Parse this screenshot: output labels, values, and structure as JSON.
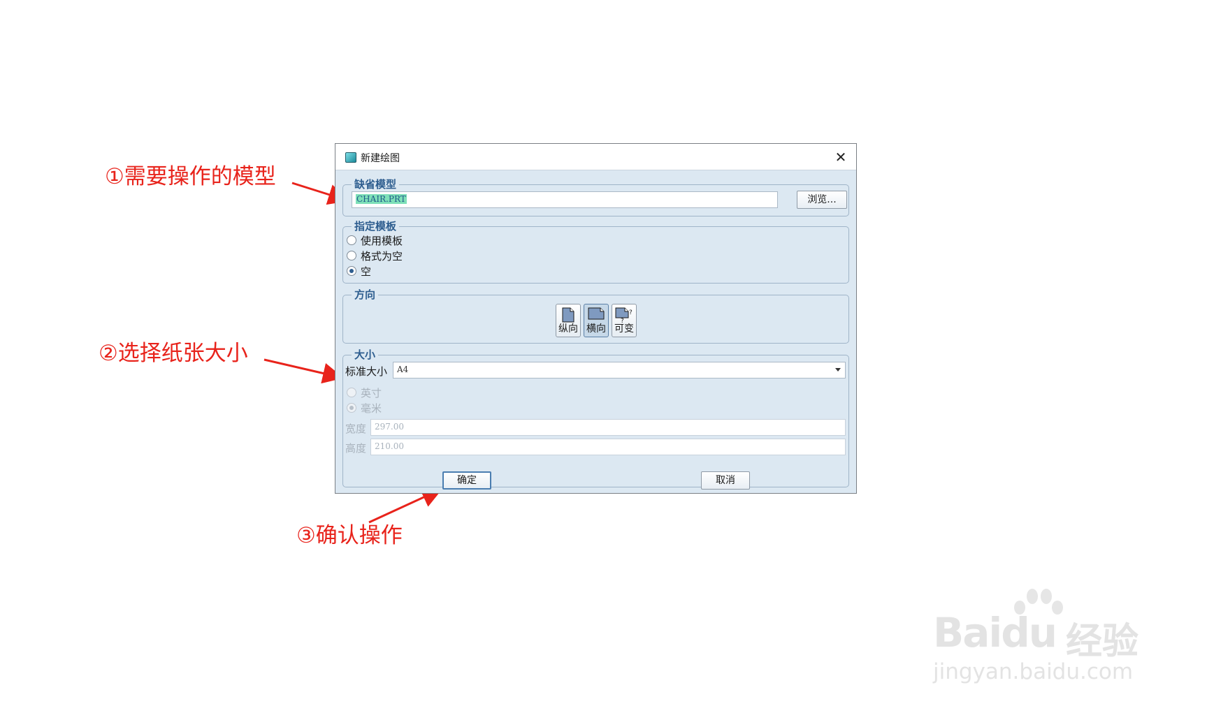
{
  "annotations": {
    "step1": "①需要操作的模型",
    "step2": "②选择纸张大小",
    "step3": "③确认操作"
  },
  "dialog": {
    "title": "新建绘图",
    "close_icon": "close-icon",
    "default_model": {
      "legend": "缺省模型",
      "value": "CHAIR.PRT",
      "browse_label": "浏览..."
    },
    "template": {
      "legend": "指定模板",
      "options": [
        "使用模板",
        "格式为空",
        "空"
      ],
      "selected": "空"
    },
    "orientation": {
      "legend": "方向",
      "options": [
        "纵向",
        "横向",
        "可变"
      ],
      "selected": "横向"
    },
    "size": {
      "legend": "大小",
      "standard_label": "标准大小",
      "standard_value": "A4",
      "units": [
        "英寸",
        "毫米"
      ],
      "unit_selected": "毫米",
      "width_label": "宽度",
      "width_value": "297.00",
      "height_label": "高度",
      "height_value": "210.00"
    },
    "ok_label": "确定",
    "cancel_label": "取消"
  },
  "watermark": {
    "logo": "Baidu",
    "brand_cn": "经验",
    "url": "jingyan.baidu.com"
  },
  "colors": {
    "annotation": "#e8231b",
    "dialog_bg": "#dce8f2",
    "legend": "#2d5d8f"
  }
}
